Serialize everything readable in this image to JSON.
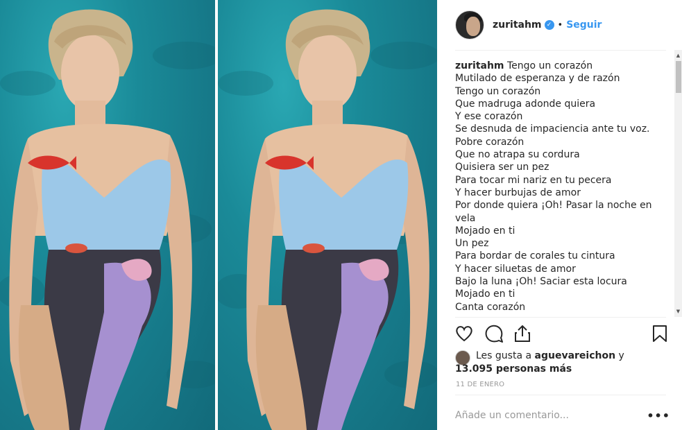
{
  "post": {
    "username": "zuritahm",
    "follow_label": "Seguir",
    "dot": "•"
  },
  "caption": {
    "username": "zuritahm",
    "lines": [
      "Tengo un corazón",
      "Mutilado de esperanza y de razón",
      "Tengo un corazón",
      "Que madruga adonde quiera",
      "Y ese corazón",
      "Se desnuda de impaciencia ante tu voz.",
      "Pobre corazón",
      "Que no atrapa su cordura",
      "Quisiera ser un pez",
      "Para tocar mi nariz en tu pecera",
      "Y hacer burbujas de amor",
      "Por donde quiera ¡Oh! Pasar la noche en vela",
      "Mojado en ti",
      "Un pez",
      "Para bordar de corales tu cintura",
      "Y hacer siluetas de amor",
      "Bajo la luna ¡Oh! Saciar esta locura",
      "Mojado en ti",
      "Canta corazón"
    ]
  },
  "likes": {
    "prefix": "Les gusta a",
    "user": "aguevareichon",
    "conj": "y",
    "count_text": "13.095 personas más"
  },
  "date": "11 DE ENERO",
  "comment": {
    "placeholder": "Añade un comentario...",
    "more": "•••"
  },
  "icons": {
    "like": "heart-icon",
    "comment": "comment-icon",
    "share": "share-icon",
    "save": "bookmark-icon",
    "verified": "verified-badge-icon"
  },
  "colors": {
    "link_blue": "#3897f0",
    "text": "#262626",
    "muted": "#999999",
    "background_teal": "#1a8a98"
  }
}
